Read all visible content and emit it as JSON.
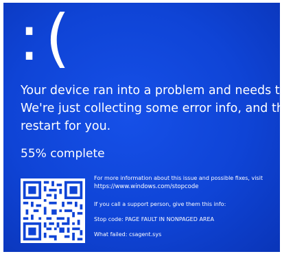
{
  "bsod": {
    "face": ":(",
    "message_lines": [
      "Your device ran into a problem and needs to restart.",
      "We're just collecting some error info, and then we'll",
      "restart for you."
    ],
    "progress_text": "55% complete",
    "progress_percent": 55,
    "info": {
      "more_info": "For more information about this issue and possible fixes, visit",
      "url": "https://www.windows.com/stopcode",
      "support_note": "If you call a support person, give them this info:",
      "stop_code": "Stop code: PAGE FAULT IN NONPAGED AREA",
      "what_failed": "What failed: csagent.sys"
    }
  },
  "colors": {
    "background": "#0f44d6",
    "text": "#ffffff"
  }
}
